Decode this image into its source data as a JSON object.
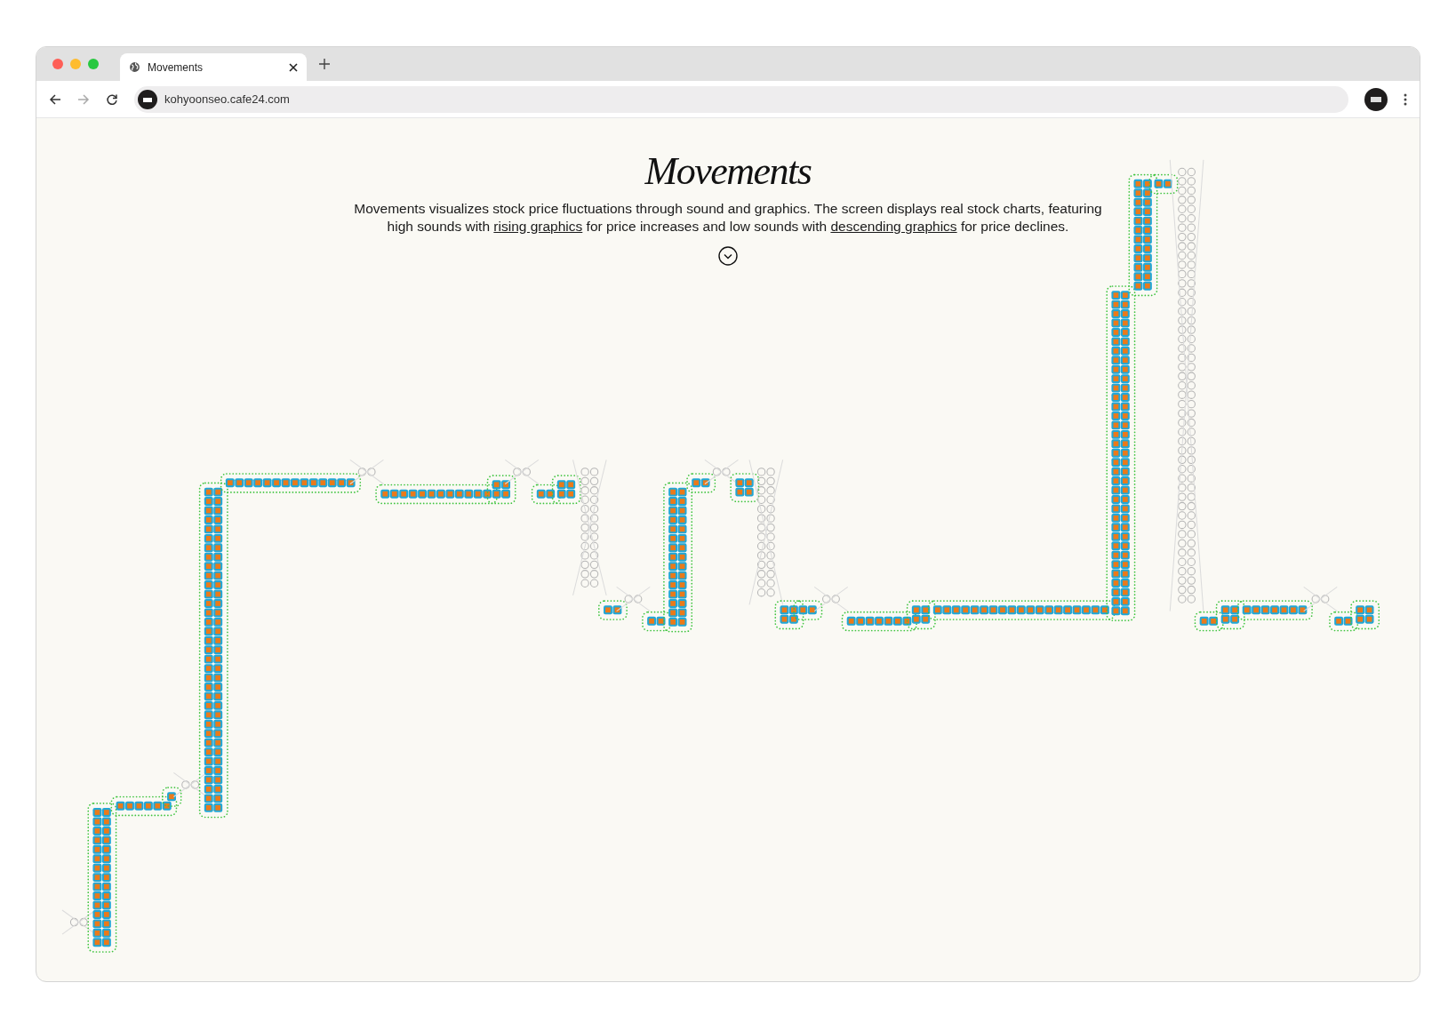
{
  "browser": {
    "tabs": [
      {
        "title": "Movements",
        "selected": true
      }
    ],
    "address": "kohyoonseo.cafe24.com"
  },
  "page": {
    "title": "Movements",
    "description": [
      {
        "kind": "text",
        "text": "Movements visualizes stock price fluctuations through sound and graphics. The screen displays real stock charts, featuring high sounds with "
      },
      {
        "kind": "link",
        "text": "rising graphics"
      },
      {
        "kind": "text",
        "text": " for price increases and low sounds with "
      },
      {
        "kind": "link",
        "text": "descending graphics"
      },
      {
        "kind": "text",
        "text": " for price declines."
      }
    ]
  }
}
